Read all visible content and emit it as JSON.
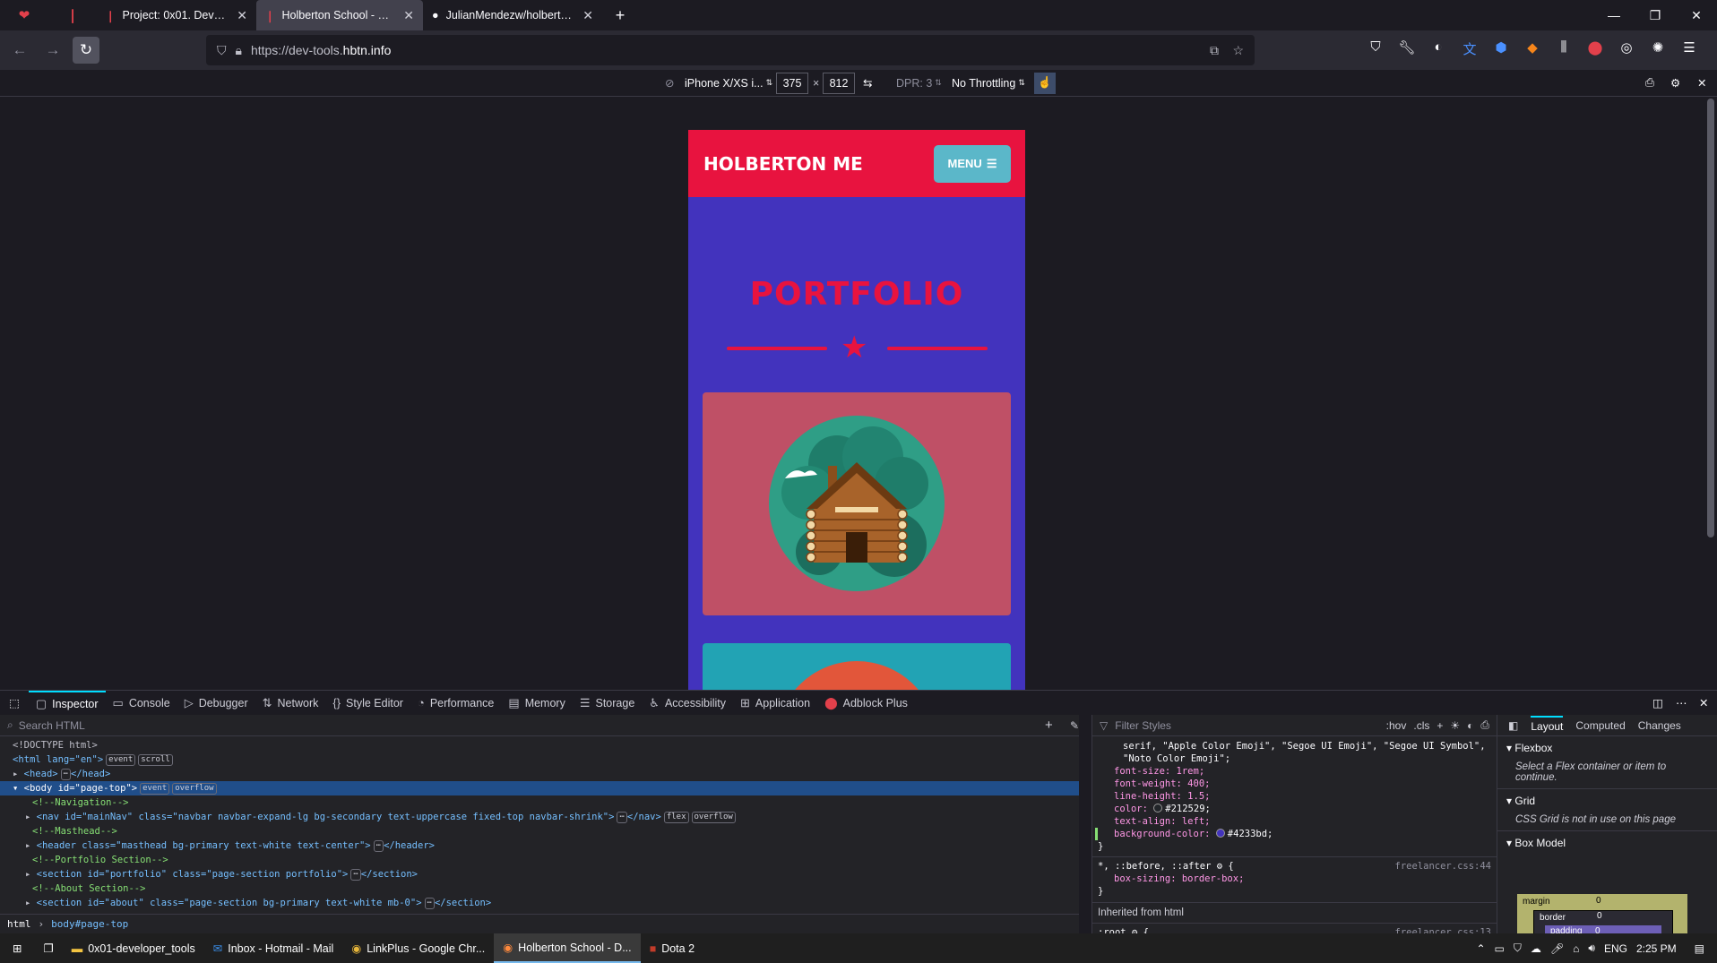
{
  "browser": {
    "tabs": [
      {
        "label": "Project: 0x01. Developer tools | ",
        "favicon": "holberton"
      },
      {
        "label": "Holberton School - Developer t",
        "favicon": "holberton",
        "active": true
      },
      {
        "label": "JulianMendezw/holbertonschoo",
        "favicon": "github"
      }
    ],
    "url_scheme": "https://dev-tools.",
    "url_domain": "hbtn.info"
  },
  "responsive": {
    "device": "iPhone X/XS i...",
    "width": "375",
    "times": "×",
    "height": "812",
    "dpr": "DPR: 3",
    "throttling": "No Throttling"
  },
  "page": {
    "brand": "HOLBERTON ME",
    "menu_label": "MENU",
    "portfolio_title": "PORTFOLIO",
    "colors": {
      "nav": "#e8133f",
      "bg": "#4233bd",
      "card1": "#bf5066",
      "card2": "#22a3b4"
    }
  },
  "devtools": {
    "tabs": [
      "Inspector",
      "Console",
      "Debugger",
      "Network",
      "Style Editor",
      "Performance",
      "Memory",
      "Storage",
      "Accessibility",
      "Application",
      "Adblock Plus"
    ],
    "search_placeholder": "Search HTML",
    "filter_placeholder": "Filter Styles",
    "hov": ":hov",
    "cls": ".cls",
    "tree": {
      "doctype": "<!DOCTYPE html>",
      "html_open": "<html lang=\"en\">",
      "head": "<head>",
      "head_close": "</head>",
      "body": "<body id=\"page-top\">",
      "c_nav": "<!--Navigation-->",
      "nav": "<nav id=\"mainNav\" class=\"navbar navbar-expand-lg bg-secondary text-uppercase fixed-top navbar-shrink\">",
      "nav_close": "</nav>",
      "c_mast": "<!--Masthead-->",
      "header": "<header class=\"masthead bg-primary text-white text-center\">",
      "header_close": "</header>",
      "c_port": "<!--Portfolio Section-->",
      "sec_port": "<section id=\"portfolio\" class=\"page-section portfolio\">",
      "sec_close": "</section>",
      "c_about": "<!--About Section-->",
      "sec_about": "<section id=\"about\" class=\"page-section bg-primary text-white mb-0\">",
      "sec_about_close": "</section>"
    },
    "badges": {
      "event": "event",
      "scroll": "scroll",
      "overflow": "overflow",
      "flex": "flex",
      "more": "⋯"
    },
    "breadcrumbs": [
      "html",
      "body#page-top"
    ],
    "css": {
      "font_line1": "serif, \"Apple Color Emoji\", \"Segoe UI Emoji\", \"Segoe UI Symbol\",",
      "font_line2": "\"Noto Color Emoji\";",
      "font_size": "font-size: 1rem;",
      "font_weight": "font-weight: 400;",
      "line_height": "line-height: 1.5;",
      "color_prop": "color:",
      "color_val": "#212529;",
      "text_align": "text-align: left;",
      "bg_prop": "background-color:",
      "bg_val": "#4233bd;",
      "close": "}",
      "rule2_sel": "*, ::before, ::after",
      "rule2_src": "freelancer.css:44",
      "box_sizing": "box-sizing: border-box;",
      "inherited": "Inherited from html",
      "root_sel": ":root",
      "root_src": "freelancer.css:13"
    },
    "layout_tabs": [
      "Layout",
      "Computed",
      "Changes"
    ],
    "layout": {
      "flexbox": "Flexbox",
      "flex_note": "Select a Flex container or item to continue.",
      "grid": "Grid",
      "grid_note": "CSS Grid is not in use on this page",
      "box_model": "Box Model",
      "margin": "margin",
      "border": "border",
      "padding": "padding",
      "zero": "0"
    }
  },
  "taskbar": {
    "items": [
      "0x01-developer_tools",
      "Inbox - Hotmail - Mail",
      "LinkPlus - Google Chr...",
      "Holberton School - D...",
      "Dota 2"
    ],
    "lang": "ENG",
    "time": "2:25 PM"
  }
}
